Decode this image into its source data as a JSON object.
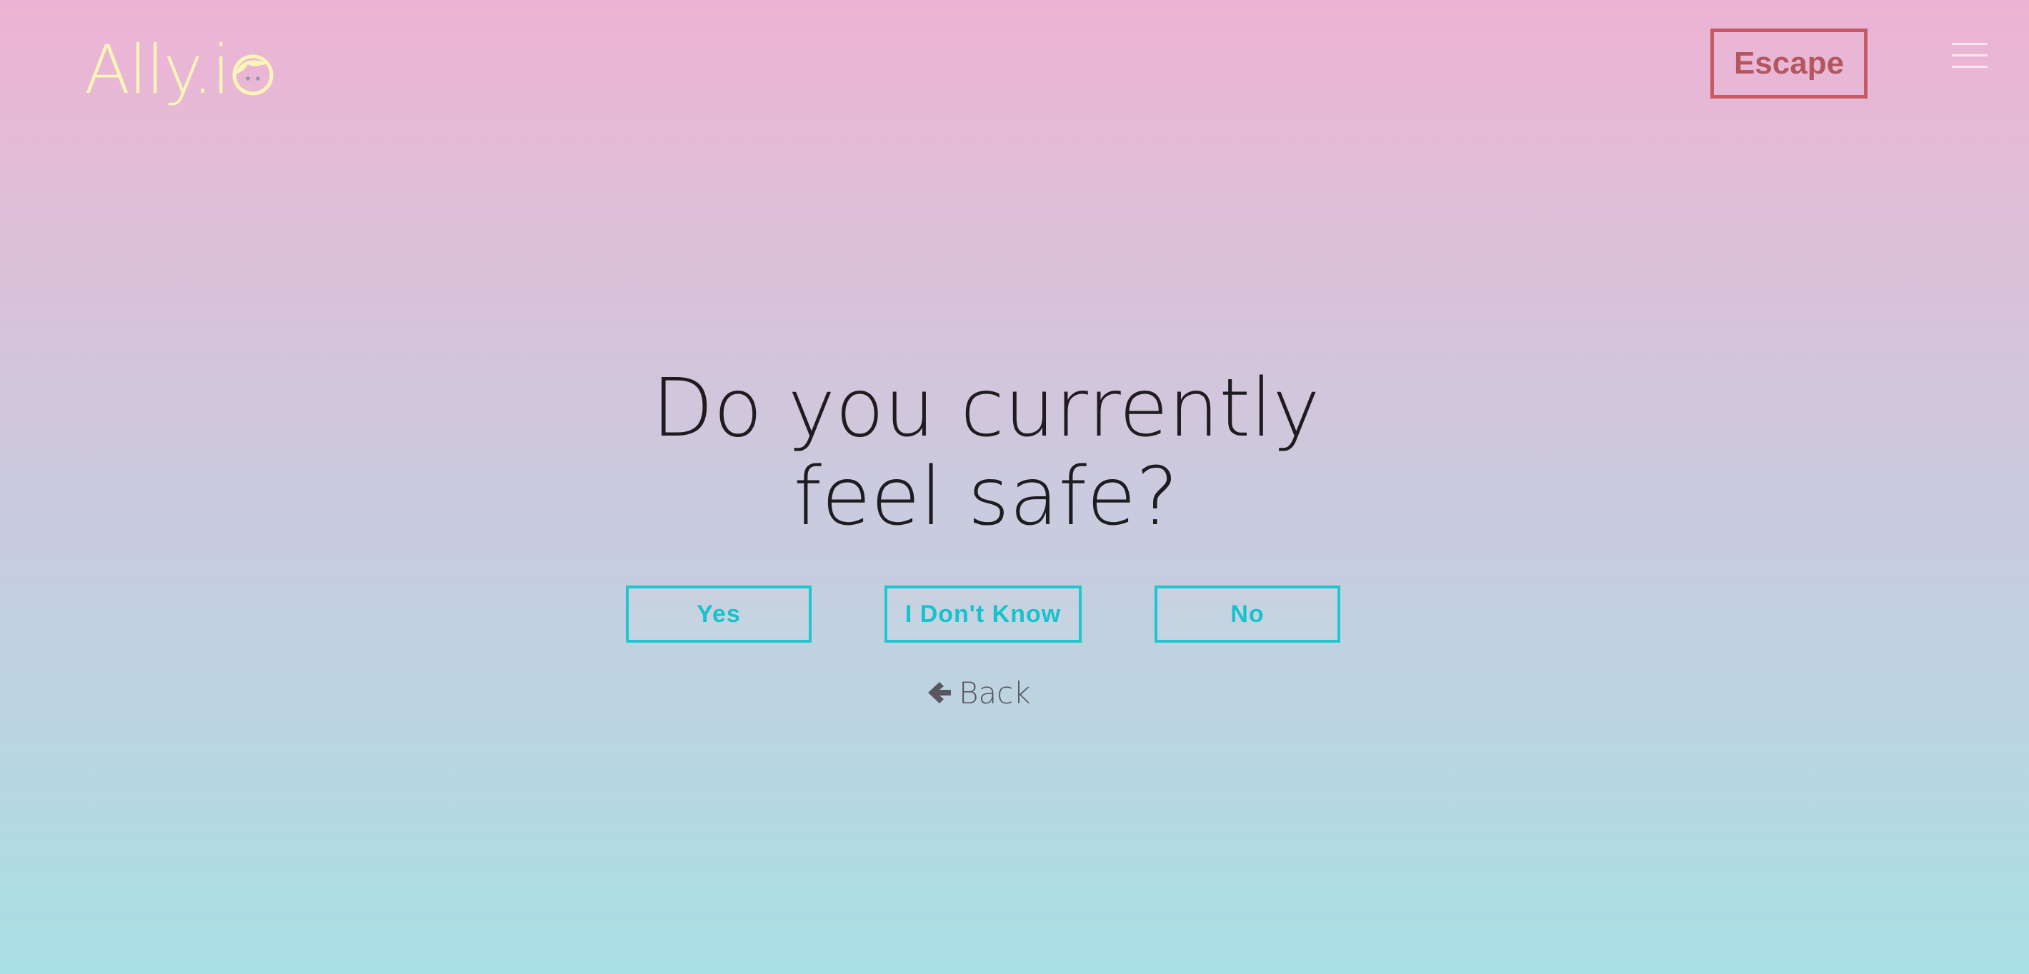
{
  "header": {
    "logo_text": "Ally.i",
    "logo_icon": "face-icon",
    "escape_label": "Escape",
    "menu_icon": "hamburger-menu-icon"
  },
  "question": {
    "line1": "Do you currently",
    "line2": "feel safe?"
  },
  "answers": [
    {
      "label": "Yes"
    },
    {
      "label": "I Don't Know"
    },
    {
      "label": "No"
    }
  ],
  "back": {
    "icon": "arrow-left-icon",
    "label": "Back"
  },
  "colors": {
    "gradient_top": "#eeb3d4",
    "gradient_bottom": "#a8dfe4",
    "logo": "#fdf6b8",
    "escape_border": "#c35a64",
    "answer_accent": "#1ec6cf",
    "question_text": "#1f1c20"
  }
}
